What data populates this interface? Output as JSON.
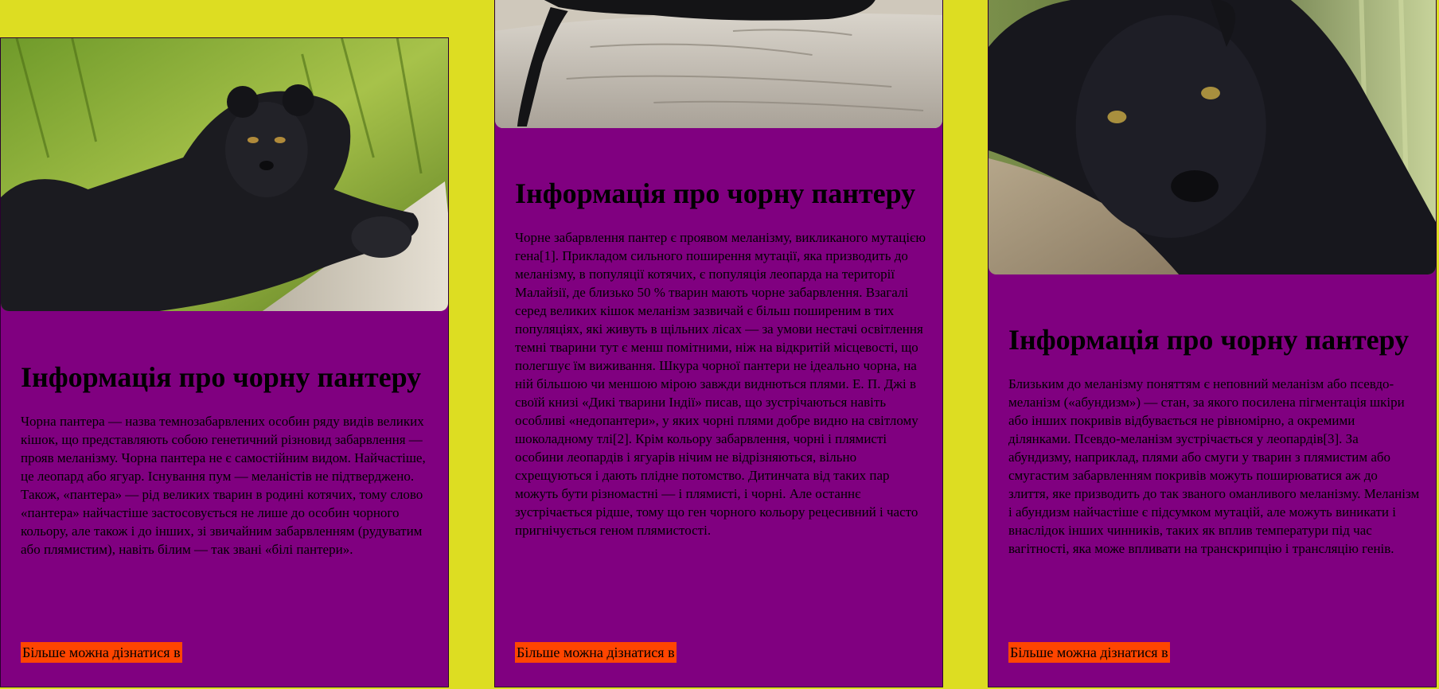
{
  "cards": [
    {
      "image_alt": "black-panther-on-log-photo",
      "title": "Інформація про чорну пантеру",
      "text": "Чорна пантера — назва темнозабарвлених особин ряду видів великих кішок, що представляють собою генетичний різновид забарвлення — прояв меланізму. Чорна пантера не є самостійним видом. Найчастіше, це леопард або ягуар. Існування пум — меланістів не підтверджено. Також, «пантера» — рід великих тварин в родині котячих, тому слово «пантера» найчастіше застосовується не лише до особин чорного кольору, але також і до інших, зі звичайним забарвленням (рудуватим або плямистим), навіть білим — так звані «білі пантери».",
      "link_label": "Більше можна дізнатися в"
    },
    {
      "image_alt": "black-panther-tail-on-log-photo",
      "title": "Інформація про чорну пантеру",
      "text": "Чорне забарвлення пантер є проявом меланізму, викликаного мутацією гена[1]. Прикладом сильного поширення мутації, яка призводить до меланізму, в популяції котячих, є популяція леопарда на території Малайзії, де близько 50 % тварин мають чорне забарвлення. Взагалі серед великих кішок меланізм зазвичай є більш поширеним в тих популяціях, які живуть в щільних лісах — за умови нестачі освітлення темні тварини тут є менш помітними, ніж на відкритій місцевості, що полегшує їм виживання. Шкура чорної пантери не ідеально чорна, на ній більшою чи меншою мірою завжди виднються плями. Е. П. Джі в своїй книзі «Дикі тварини Індії» писав, що зустрічаються навіть особливі «недопантери», у яких чорні плями добре видно на світлому шоколадному тлі[2]. Крім кольору забарвлення, чорні і плямисті особини леопардів і ягуарів нічим не відрізняються, вільно схрещуються і дають плідне потомство. Дитинчата від таких пар можуть бути різномастні — і плямисті, і чорні. Але останнє зустрічається рідше, тому що ген чорного кольору рецесивний і часто пригнічується геном плямистості.",
      "link_label": "Більше можна дізнатися в"
    },
    {
      "image_alt": "black-panther-closeup-photo",
      "title": "Інформація про чорну пантеру",
      "text": "Близьким до меланізму поняттям є неповний меланізм або псевдо-меланізм («абундизм») — стан, за якого посилена пігментація шкіри або інших покривів відбувається не рівномірно, а окремими ділянками. Псевдо-меланізм зустрічається у леопардів[3]. За абундизму, наприклад, плями або смуги у тварин з плямистим або смугастим забарвленням покривів можуть поширюватися аж до злиття, яке призводить до так званого оманливого меланізму. Меланізм і абундизм найчастіше є підсумком мутацій, але можуть виникати і внаслідок інших чинників, таких як вплив температури під час вагітності, яка може впливати на транскрипцію і трансляцію генів.",
      "link_label": "Більше можна дізнатися в"
    }
  ],
  "colors": {
    "page_background": "#dddd22",
    "card_background": "#800080",
    "link_background": "#ff4500"
  }
}
